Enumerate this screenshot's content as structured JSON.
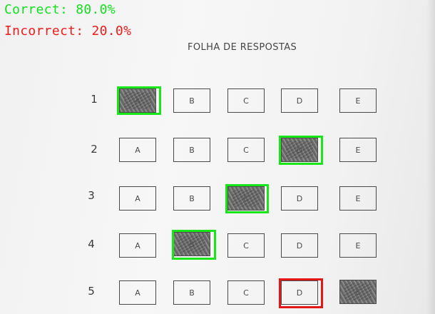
{
  "results": {
    "correct_label": "Correct:",
    "correct_value": "80.0%",
    "incorrect_label": "Incorrect:",
    "incorrect_value": "20.0%",
    "correct_color": "#12e01e",
    "incorrect_color": "#ec1c1c"
  },
  "sheet": {
    "title": "FOLHA DE RESPOSTAS",
    "options": [
      "A",
      "B",
      "C",
      "D",
      "E"
    ],
    "questions": [
      {
        "number": "1",
        "marked": "A",
        "result": "correct"
      },
      {
        "number": "2",
        "marked": "D",
        "result": "correct"
      },
      {
        "number": "3",
        "marked": "C",
        "result": "correct"
      },
      {
        "number": "4",
        "marked": "B",
        "result": "correct"
      },
      {
        "number": "5",
        "marked": "E",
        "result": "incorrect",
        "expected": "D"
      }
    ]
  }
}
